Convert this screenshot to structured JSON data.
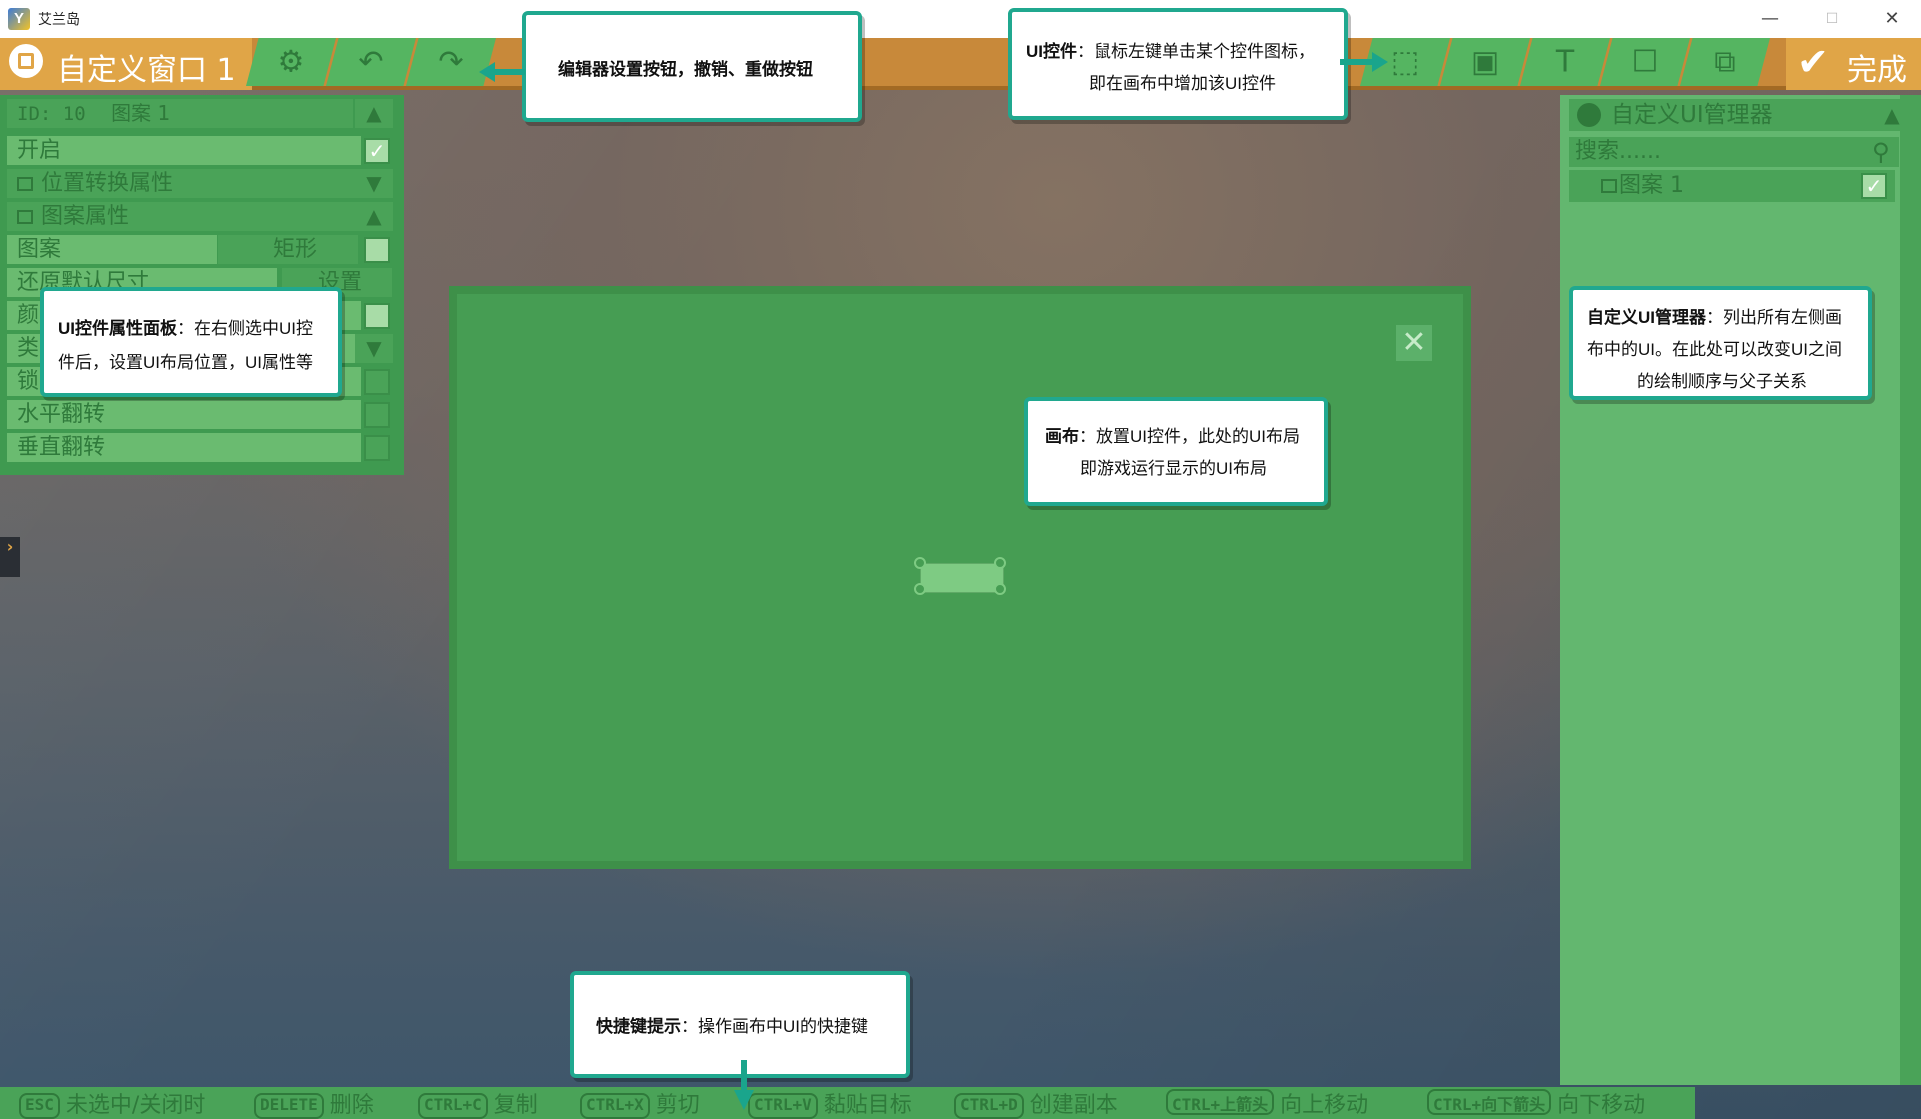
{
  "app": {
    "title": "艾兰岛",
    "icon_glyph": "Y"
  },
  "window_controls": {
    "minimize": "—",
    "maximize": "☐",
    "close": "✕"
  },
  "toolbar": {
    "window_title": "自定义窗口 1",
    "settings_icon": "gear-icon",
    "undo_icon": "undo-icon",
    "redo_icon": "redo-icon",
    "controls": [
      "add-rect-icon",
      "add-image-icon",
      "add-text-icon",
      "add-button-icon",
      "add-image-button-icon"
    ],
    "done_label": "完成"
  },
  "properties": {
    "id_label": "ID: 10",
    "name": "图案 1",
    "rows": [
      {
        "label": "开启"
      },
      {
        "label": "位置转换属性"
      },
      {
        "label": "图案属性"
      },
      {
        "label": "图案",
        "value": "矩形"
      },
      {
        "label": "还原默认尺寸",
        "value": "设置"
      },
      {
        "label": "颜"
      },
      {
        "label": "类"
      },
      {
        "label": "锁"
      },
      {
        "label": "水平翻转"
      },
      {
        "label": "垂直翻转"
      }
    ]
  },
  "manager": {
    "title": "自定义UI管理器",
    "search_placeholder": "搜索......",
    "items": [
      {
        "label": "图案 1"
      }
    ]
  },
  "shortcuts": [
    {
      "key": "ESC",
      "label": "未选中/关闭时"
    },
    {
      "key": "DELETE",
      "label": "删除"
    },
    {
      "key": "CTRL+C",
      "label": "复制"
    },
    {
      "key": "CTRL+X",
      "label": "剪切"
    },
    {
      "key": "CTRL+V",
      "label": "黏贴目标"
    },
    {
      "key": "CTRL+D",
      "label": "创建副本"
    },
    {
      "key": "CTRL+上箭头",
      "label": "向上移动"
    },
    {
      "key": "CTRL+向下箭头",
      "label": "向下移动"
    }
  ],
  "callouts": {
    "editor": {
      "bold": "编辑器设置按钮，撤销、重做按钮",
      "text": ""
    },
    "controls": {
      "bold": "UI控件",
      "text": "：鼠标左键单击某个控件图标，",
      "line2": "即在画布中增加该UI控件"
    },
    "props": {
      "bold": "UI控件属性面板",
      "text": "：在右侧选中UI控",
      "line2": "件后，设置UI布局位置，UI属性等"
    },
    "manager": {
      "bold": "自定义UI管理器",
      "text": "：列出所有左侧画",
      "line2": "布中的UI。在此处可以改变UI之间",
      "line3": "的绘制顺序与父子关系"
    },
    "canvas": {
      "bold": "画布",
      "text": "：放置UI控件，此处的UI布局",
      "line2": "即游戏运行显示的UI布局"
    },
    "shortcut": {
      "bold": "快捷键提示",
      "text": "：操作画布中UI的快捷键"
    }
  },
  "colors": {
    "orange": "#e0a547",
    "green": "#469d53",
    "accent": "#20a88f"
  }
}
